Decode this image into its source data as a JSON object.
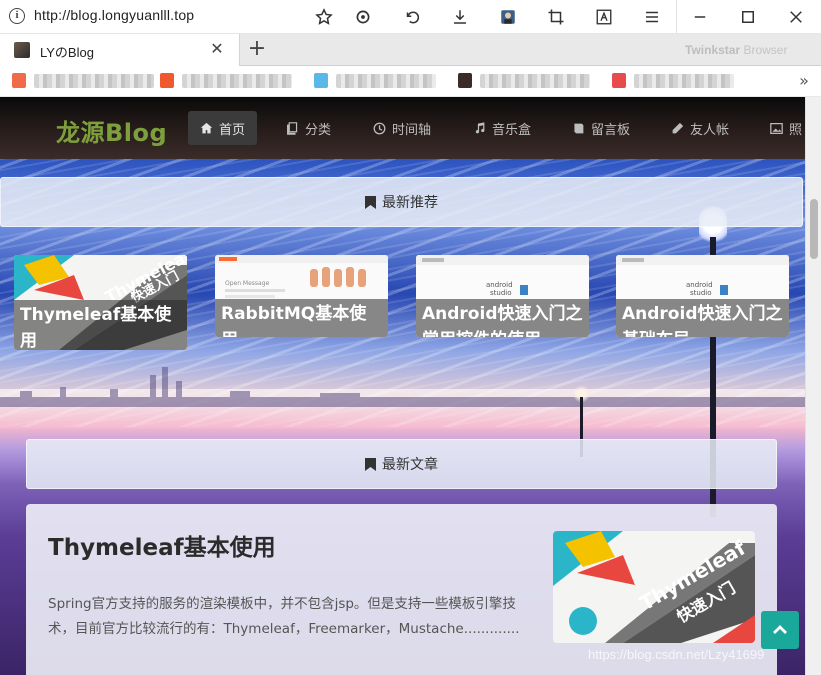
{
  "browser": {
    "url": "http://blog.longyuanlll.top",
    "tab_title": "LYのBlog",
    "brand": "Twinkstar",
    "brand_suffix": " Browser",
    "icons": [
      "info-icon",
      "star-icon",
      "refresh-icon",
      "undo-icon",
      "download-icon",
      "avatar-icon",
      "crop-icon",
      "translate-icon",
      "menu-icon",
      "minimize-icon",
      "maximize-icon",
      "close-icon"
    ]
  },
  "site": {
    "logo": "龙源Blog",
    "nav": [
      {
        "label": "首页",
        "icon": "home-icon",
        "active": true
      },
      {
        "label": "分类",
        "icon": "copy-icon"
      },
      {
        "label": "时间轴",
        "icon": "clock-icon"
      },
      {
        "label": "音乐盒",
        "icon": "music-icon"
      },
      {
        "label": "留言板",
        "icon": "book-icon"
      },
      {
        "label": "友人帐",
        "icon": "pencil-icon"
      },
      {
        "label": "照",
        "icon": "image-icon"
      }
    ]
  },
  "recommended": {
    "header": "最新推荐",
    "cards": [
      {
        "title": "Thymeleaf基本使用"
      },
      {
        "title": "RabbitMQ基本使用"
      },
      {
        "title": "Android快速入门之常用控件的使用"
      },
      {
        "title": "Android快速入门之基础布局"
      }
    ]
  },
  "latest": {
    "header": "最新文章",
    "article": {
      "title": "Thymeleaf基本使用",
      "summary": "Spring官方支持的服务的渲染模板中，并不包含jsp。但是支持一些模板引擎技术，目前官方比较流行的有：Thymeleaf，Freemarker，Mustache............."
    }
  },
  "watermark": "https://blog.csdn.net/Lzy41699",
  "colors": {
    "logo": "#7ea03c",
    "back_to_top": "#1aa89a",
    "nav_active": "#3b3b3b"
  }
}
